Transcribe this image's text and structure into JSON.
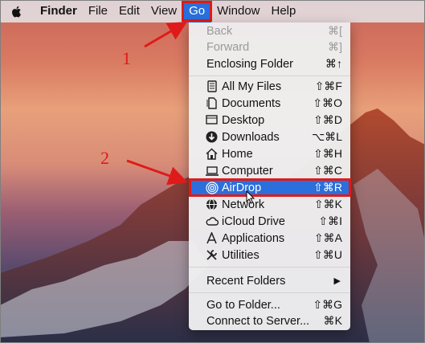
{
  "menubar": {
    "apple_icon": "apple-logo-icon",
    "items": [
      "Finder",
      "File",
      "Edit",
      "View",
      "Go",
      "Window",
      "Help"
    ]
  },
  "go_menu": {
    "items": [
      {
        "label": "Back",
        "shortcut": "⌘[",
        "enabled": false
      },
      {
        "label": "Forward",
        "shortcut": "⌘]",
        "enabled": false
      },
      {
        "label": "Enclosing Folder",
        "shortcut": "⌘↑",
        "enabled": true
      },
      {
        "label": "All My Files",
        "shortcut": "⇧⌘F",
        "icon": "all-my-files-icon"
      },
      {
        "label": "Documents",
        "shortcut": "⇧⌘O",
        "icon": "documents-icon"
      },
      {
        "label": "Desktop",
        "shortcut": "⇧⌘D",
        "icon": "desktop-icon"
      },
      {
        "label": "Downloads",
        "shortcut": "⌥⌘L",
        "icon": "downloads-icon"
      },
      {
        "label": "Home",
        "shortcut": "⇧⌘H",
        "icon": "home-icon"
      },
      {
        "label": "Computer",
        "shortcut": "⇧⌘C",
        "icon": "computer-icon"
      },
      {
        "label": "AirDrop",
        "shortcut": "⇧⌘R",
        "icon": "airdrop-icon",
        "highlighted": true
      },
      {
        "label": "Network",
        "shortcut": "⇧⌘K",
        "icon": "network-icon"
      },
      {
        "label": "iCloud Drive",
        "shortcut": "⇧⌘I",
        "icon": "icloud-icon"
      },
      {
        "label": "Applications",
        "shortcut": "⇧⌘A",
        "icon": "applications-icon"
      },
      {
        "label": "Utilities",
        "shortcut": "⇧⌘U",
        "icon": "utilities-icon"
      },
      {
        "label": "Recent Folders",
        "submenu_indicator": "▶"
      },
      {
        "label": "Go to Folder...",
        "shortcut": "⇧⌘G"
      },
      {
        "label": "Connect to Server...",
        "shortcut": "⌘K"
      }
    ]
  },
  "annotations": {
    "step1": "1",
    "step2": "2"
  },
  "colors": {
    "highlight": "#2a6fdb",
    "annotation_red": "#e01a1a"
  }
}
